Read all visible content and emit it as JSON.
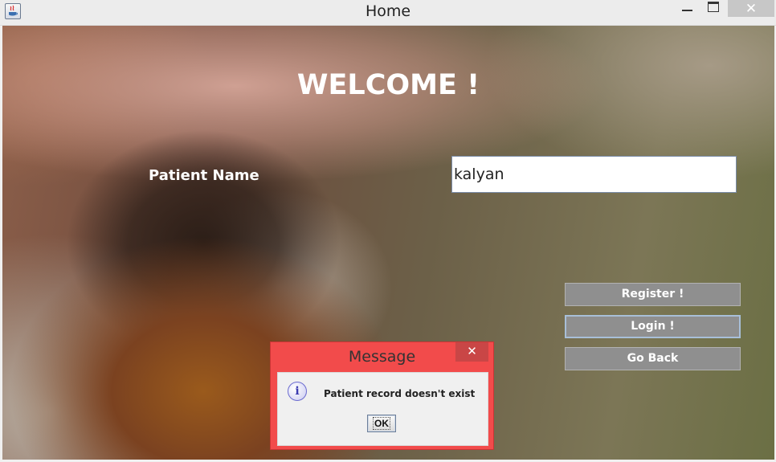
{
  "window": {
    "title": "Home",
    "icon": "java-cup-icon",
    "controls": {
      "minimize": "minimize-icon",
      "maximize": "maximize-icon",
      "close": "✕"
    }
  },
  "main": {
    "heading": "WELCOME !",
    "patient_name_label": "Patient Name",
    "patient_name_value": "kalyan",
    "buttons": {
      "register": "Register !",
      "login": "Login !",
      "go_back": "Go Back"
    }
  },
  "dialog": {
    "title": "Message",
    "close": "✕",
    "icon": "info-icon",
    "icon_glyph": "i",
    "message": "Patient record doesn't exist",
    "ok_label": "OK"
  },
  "colors": {
    "dialog_frame": "#f24b4b",
    "button_bg": "#8f8f8f",
    "heading_text": "#ffffff"
  }
}
